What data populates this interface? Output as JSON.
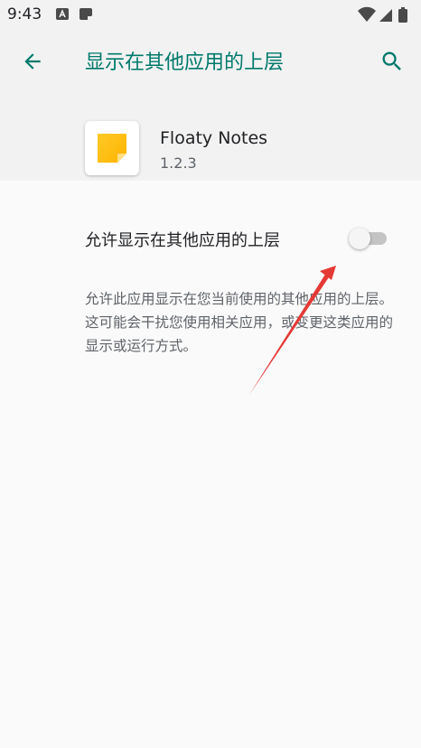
{
  "status_bar": {
    "time": "9:43",
    "icons": [
      "font-notification-icon",
      "notes-notification-icon",
      "wifi-icon",
      "cellular-icon",
      "battery-icon"
    ]
  },
  "app_bar": {
    "title": "显示在其他应用的上层",
    "accent_color": "#00796b"
  },
  "app_info": {
    "name": "Floaty Notes",
    "version": "1.2.3",
    "icon": "sticky-note-icon"
  },
  "setting": {
    "label": "允许显示在其他应用的上层",
    "enabled": false
  },
  "description": "允许此应用显示在您当前使用的其他应用的上层。这可能会干扰您使用相关应用，或变更这类应用的显示或运行方式。",
  "annotation": {
    "color": "#e53935"
  }
}
